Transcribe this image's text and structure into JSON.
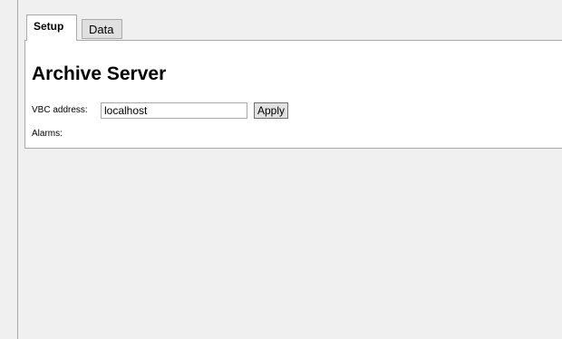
{
  "tabs": [
    {
      "label": "Setup",
      "active": true
    },
    {
      "label": "Data",
      "active": false
    }
  ],
  "setup": {
    "title": "Archive Server",
    "vbc_label": "VBC address:",
    "vbc_value": "localhost",
    "apply_label": "Apply",
    "alarms_label": "Alarms:"
  },
  "colors": {
    "background": "#f0f0f0",
    "panel": "#ffffff",
    "border": "#a9a9a9",
    "inactive_tab": "#e0e0e0",
    "button": "#e1e1e1"
  }
}
